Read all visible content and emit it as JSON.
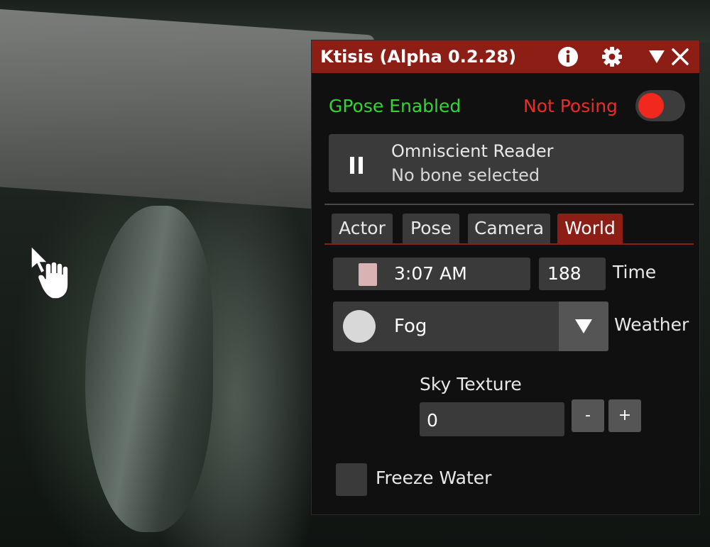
{
  "window": {
    "title": "Ktisis (Alpha 0.2.28)",
    "icons": {
      "info": "info-icon",
      "settings": "gear-icon",
      "collapse": "triangle-down-icon",
      "close": "close-icon"
    }
  },
  "status": {
    "gpose": "GPose Enabled",
    "posing": "Not Posing",
    "posing_toggle_on": false,
    "colors": {
      "gpose": "#33d533",
      "posing": "#f02a24",
      "accent": "#8c1e16"
    }
  },
  "target": {
    "name": "Omniscient Reader",
    "bone": "No bone selected",
    "icon": "pause-icon"
  },
  "tabs": [
    {
      "label": "Actor",
      "active": false
    },
    {
      "label": "Pose",
      "active": false
    },
    {
      "label": "Camera",
      "active": false
    },
    {
      "label": "World",
      "active": true
    }
  ],
  "world": {
    "time_display": "3:07 AM",
    "time_value": "188",
    "time_label": "Time",
    "weather_value": "Fog",
    "weather_label": "Weather",
    "sky_label": "Sky Texture",
    "sky_value": "0",
    "sky_minus": "-",
    "sky_plus": "+",
    "freeze_label": "Freeze Water",
    "freeze_checked": false
  }
}
